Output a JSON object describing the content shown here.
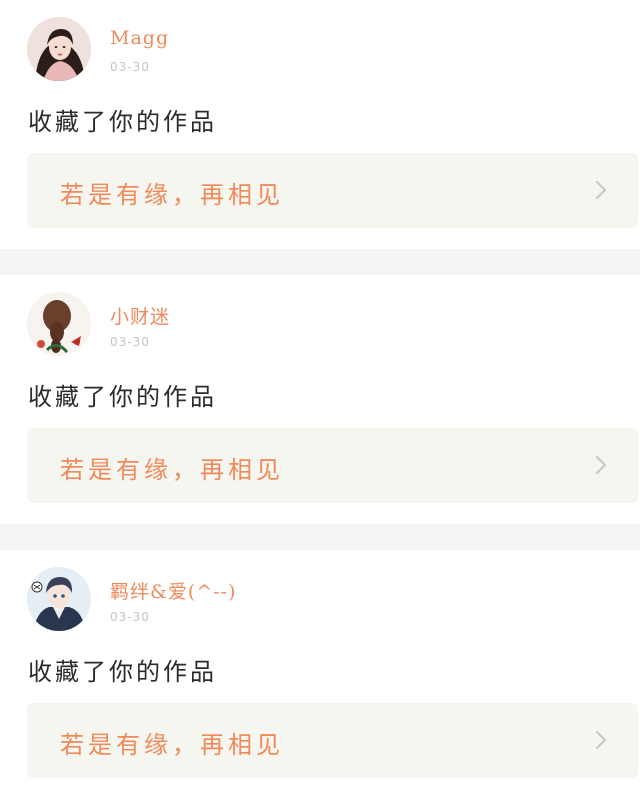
{
  "notifications": [
    {
      "username": "Magg",
      "date": "03-30",
      "action": "收藏了你的作品",
      "work_title": "若是有缘，再相见",
      "avatar_icon": "avatar-woman-hanfu"
    },
    {
      "username": "小财迷",
      "date": "03-30",
      "action": "收藏了你的作品",
      "work_title": "若是有缘，再相见",
      "avatar_icon": "avatar-braided-hair"
    },
    {
      "username": "羁绊&爱(^--)",
      "date": "03-30",
      "action": "收藏了你的作品",
      "work_title": "若是有缘，再相见",
      "avatar_icon": "avatar-anime-boy"
    }
  ],
  "colors": {
    "accent": "#f08a5b",
    "date": "#c4c4c4",
    "card_bg": "#f6f6f1",
    "separator": "#f5f5f5"
  }
}
